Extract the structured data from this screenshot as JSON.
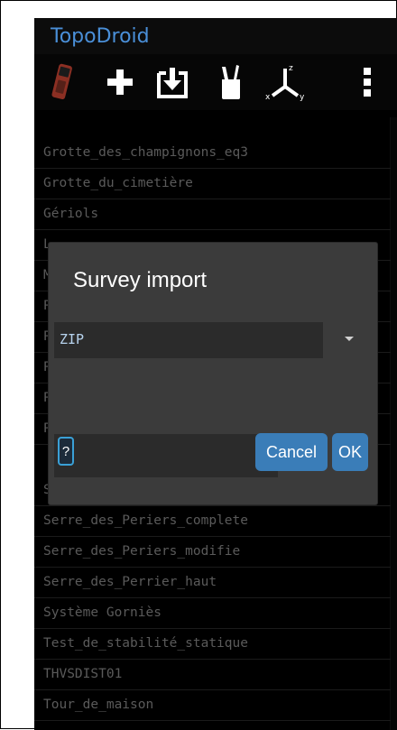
{
  "app": {
    "title": "TopoDroid"
  },
  "toolbar": {
    "icons": [
      "device-icon",
      "add-icon",
      "import-icon",
      "sketch-icon",
      "axes-icon",
      "overflow-icon"
    ]
  },
  "surveys": [
    {
      "label": "Grotte_des_champignons_eq3"
    },
    {
      "label": "Grotte_du_cimetière"
    },
    {
      "label": "Gériols"
    },
    {
      "label": "L"
    },
    {
      "label": "M"
    },
    {
      "label": "P"
    },
    {
      "label": "P"
    },
    {
      "label": "P"
    },
    {
      "label": "P"
    },
    {
      "label": "P"
    },
    {
      "label": "S"
    },
    {
      "label": "Serre_des_Periers_complete"
    },
    {
      "label": "Serre_des_Periers_modifie"
    },
    {
      "label": "Serre_des_Perrier_haut"
    },
    {
      "label": "Système Gorniès"
    },
    {
      "label": "Test_de_stabilité_statique"
    },
    {
      "label": "THVSDIST01"
    },
    {
      "label": "Tour_de_maison"
    }
  ],
  "dialog": {
    "title": "Survey import",
    "format_selected": "ZIP",
    "help_label": "?",
    "cancel_label": "Cancel",
    "ok_label": "OK"
  },
  "colors": {
    "accent": "#3a7db8",
    "title": "#4a8fd8",
    "list_text": "#8a8a8a",
    "dialog_bg": "#3b3b3b"
  }
}
